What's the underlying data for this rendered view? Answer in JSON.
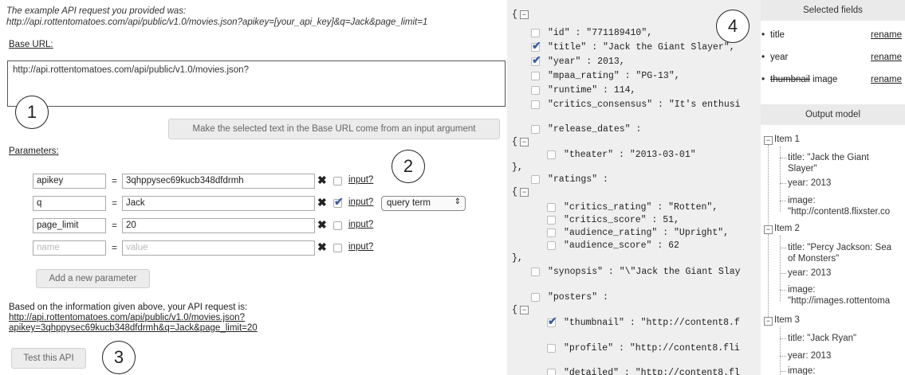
{
  "left": {
    "intro_line1": "The example API request you provided was:",
    "intro_line2": "http://api.rottentomatoes.com/api/public/v1.0/movies.json?apikey=[your_api_key]&q=Jack&page_limit=1",
    "base_url_label": "Base URL",
    "base_url_value": "http://api.rottentomatoes.com/api/public/v1.0/movies.json?",
    "make_input_button": "Make the selected text in the Base URL come from an input argument",
    "parameters_label": "Parameters",
    "params": [
      {
        "name": "apikey",
        "value": "3qhppysec69kucb348dfdrmh",
        "input_checked": false
      },
      {
        "name": "q",
        "value": "Jack",
        "input_checked": true,
        "select": "query term"
      },
      {
        "name": "page_limit",
        "value": "20",
        "input_checked": false
      }
    ],
    "new_param_placeholder_name": "name",
    "new_param_placeholder_value": "value",
    "eq": "=",
    "remove_glyph": "✖",
    "input_q_label": "input?",
    "add_param_button": "Add a new parameter",
    "result_text": "Based on the information given above, your API request is:",
    "result_link1": "http://api.rottentomatoes.com/api/public/v1.0/movies.json?",
    "result_link2": "apikey=3qhppysec69kucb348dfdrmh&q=Jack&page_limit=20",
    "test_button": "Test this API"
  },
  "markers": [
    "1",
    "2",
    "3",
    "4"
  ],
  "json_tree": {
    "open_brace": "{",
    "close_brace": "},",
    "lines": [
      {
        "text": "\"id\" : \"771189410\",",
        "checked": false
      },
      {
        "text": "\"title\" : \"Jack the Giant Slayer\",",
        "checked": true
      },
      {
        "text": "\"year\" : 2013,",
        "checked": true
      },
      {
        "text": "\"mpaa_rating\" : \"PG-13\",",
        "checked": false
      },
      {
        "text": "\"runtime\" : 114,",
        "checked": false
      },
      {
        "text": "\"critics_consensus\" : \"It's enthusi",
        "checked": false
      },
      {
        "text": "\"release_dates\" :",
        "checked": false
      },
      {
        "text": "\"theater\" : \"2013-03-01\"",
        "checked": false
      },
      {
        "text": "\"ratings\" :",
        "checked": false
      },
      {
        "text": "\"critics_rating\" : \"Rotten\",",
        "checked": false
      },
      {
        "text": "\"critics_score\" : 51,",
        "checked": false
      },
      {
        "text": "\"audience_rating\" : \"Upright\",",
        "checked": false
      },
      {
        "text": "\"audience_score\" : 62",
        "checked": false
      },
      {
        "text": "\"synopsis\" : \"\\\"Jack the Giant Slay",
        "checked": false
      },
      {
        "text": "\"posters\" :",
        "checked": false
      },
      {
        "text": "\"thumbnail\" : \"http://content8.f",
        "checked": true
      },
      {
        "text": "\"profile\" : \"http://content8.fli",
        "checked": false
      },
      {
        "text": "\"detailed\" : \"http://content8.fl",
        "checked": false
      }
    ]
  },
  "selected_fields": {
    "header": "Selected fields",
    "items": [
      {
        "label": "title",
        "action": "rename"
      },
      {
        "label": "year",
        "action": "rename"
      },
      {
        "label_struck": "thumbnail",
        "label": "image",
        "action": "rename"
      }
    ]
  },
  "output_model": {
    "header": "Output model",
    "items": [
      {
        "label": "Item 1",
        "title": "title: \"Jack the Giant",
        "title2": "Slayer\"",
        "year": "year: 2013",
        "image": "image:",
        "image2": "\"http://content8.flixster.co"
      },
      {
        "label": "Item 2",
        "title": "title: \"Percy Jackson: Sea",
        "title2": "of Monsters\"",
        "year": "year: 2013",
        "image": "image:",
        "image2": "\"http://images.rottentoma"
      },
      {
        "label": "Item 3",
        "title": "title: \"Jack Ryan\"",
        "year": "year: 2013",
        "image": "image:"
      }
    ]
  }
}
